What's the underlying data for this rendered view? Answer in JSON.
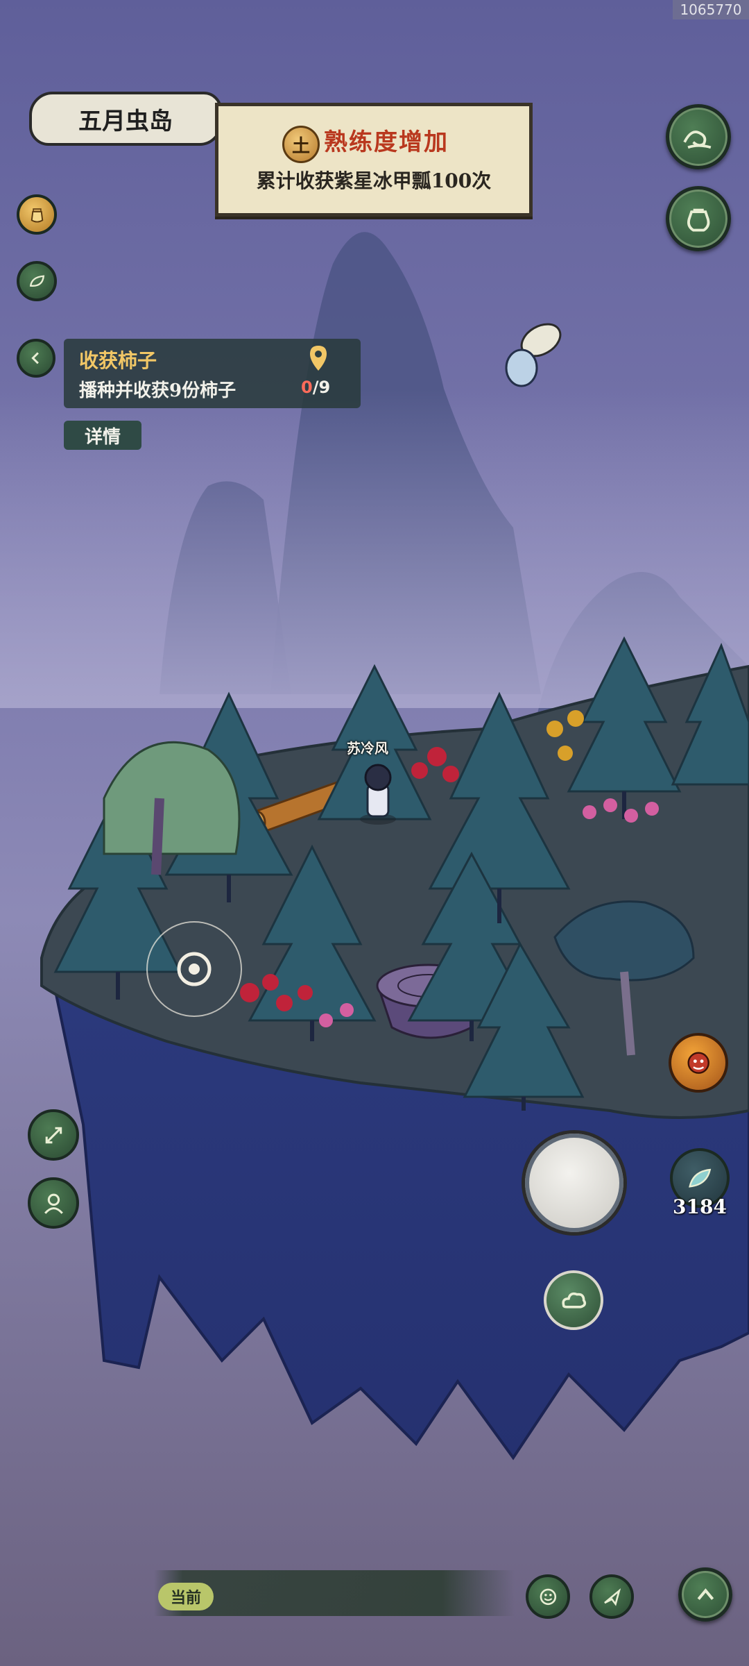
{
  "watermark": "1065770",
  "map": {
    "title": "五月虫岛"
  },
  "notice": {
    "badge": "土",
    "title": "熟练度增加",
    "subtitle": "累计收获紫星冰甲瓢100次"
  },
  "quest": {
    "title": "收获柿子",
    "description": "播种并收获9份柿子",
    "progress_current": "0",
    "progress_total": "/9",
    "detail_label": "详情"
  },
  "player": {
    "name": "苏冷风"
  },
  "resource": {
    "count": "3184",
    "icon": "leaf-feather-icon"
  },
  "bottom_bar": {
    "current_label": "当前"
  },
  "colors": {
    "sky": "#6c6a9c",
    "cliff": "#2f3b7e",
    "grass": "#3e4a53",
    "tree": "#2f5a6a",
    "button_green": "#3f6a48",
    "quest_title": "#f2c766",
    "notice_title": "#b9381e"
  }
}
